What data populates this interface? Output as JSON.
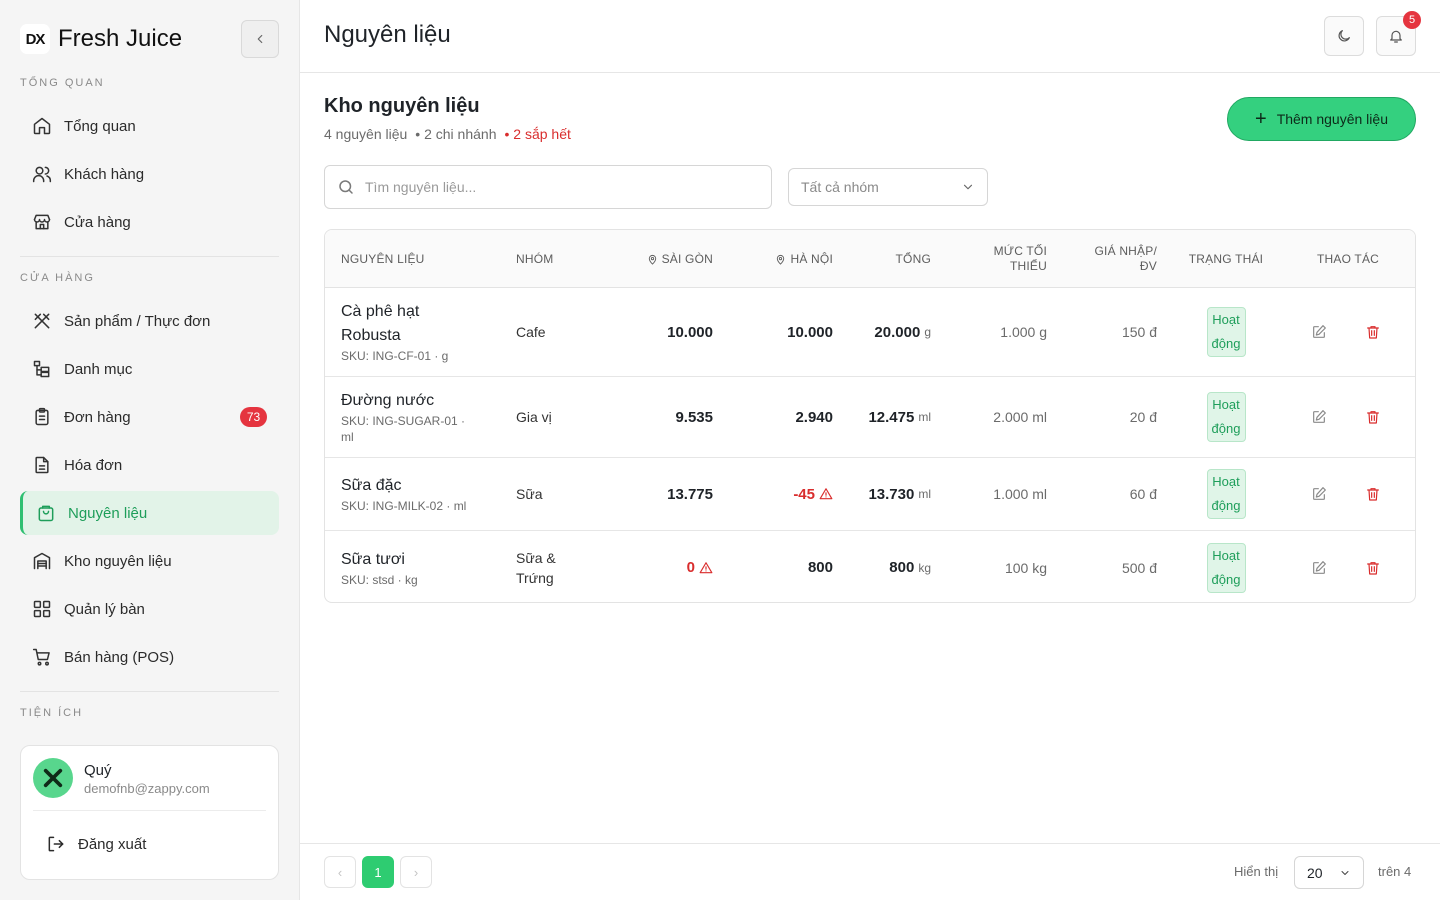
{
  "brand": {
    "logo_text": "DX",
    "name": "Fresh Juice"
  },
  "sidebar": {
    "sections": [
      "TỔNG QUAN",
      "CỬA HÀNG",
      "TIỆN ÍCH"
    ],
    "overview_items": [
      {
        "label": "Tổng quan",
        "icon": "home-icon"
      },
      {
        "label": "Khách hàng",
        "icon": "users-icon"
      },
      {
        "label": "Cửa hàng",
        "icon": "store-icon"
      }
    ],
    "store_items": [
      {
        "label": "Sản phẩm / Thực đơn",
        "icon": "utensils-icon"
      },
      {
        "label": "Danh mục",
        "icon": "category-tree-icon"
      },
      {
        "label": "Đơn hàng",
        "icon": "clipboard-icon",
        "badge": "73"
      },
      {
        "label": "Hóa đơn",
        "icon": "invoice-icon"
      },
      {
        "label": "Nguyên liệu",
        "icon": "shopping-bag-icon",
        "active": true
      },
      {
        "label": "Kho nguyên liệu",
        "icon": "warehouse-icon"
      },
      {
        "label": "Quản lý bàn",
        "icon": "grid-icon"
      },
      {
        "label": "Bán hàng (POS)",
        "icon": "cart-icon"
      }
    ],
    "user": {
      "name": "Quý",
      "email": "demofnb@zappy.com",
      "logout_label": "Đăng xuất"
    }
  },
  "header": {
    "title": "Nguyên liệu",
    "notification_count": "5"
  },
  "content": {
    "title": "Kho nguyên liệu",
    "subtitle_count": "4 nguyên liệu",
    "subtitle_branches": "• 2 chi nhánh",
    "subtitle_warning": "• 2 sắp hết",
    "add_button_label": "Thêm nguyên liệu",
    "search_placeholder": "Tìm nguyên liệu...",
    "group_filter_value": "Tất cả nhóm"
  },
  "table": {
    "columns": {
      "ingredient": "NGUYÊN LIỆU",
      "group": "NHÓM",
      "saigon": "SÀI GÒN",
      "hanoi": "HÀ NỘI",
      "total": "TỔNG",
      "min_level_line1": "MỨC TỐI",
      "min_level_line2": "THIỂU",
      "price_line1": "GIÁ NHẬP/",
      "price_line2": "ĐV",
      "status": "TRẠNG THÁI",
      "actions": "THAO TÁC"
    },
    "rows": [
      {
        "name_line1": "Cà phê hạt",
        "name_line2": "Robusta",
        "sku": "SKU: ING-CF-01 · g",
        "group_line1": "Cafe",
        "group_line2": "",
        "saigon": "10.000",
        "saigon_low": false,
        "hanoi": "10.000",
        "hanoi_low": false,
        "total": "20.000",
        "total_unit": "g",
        "min_level": "1.000 g",
        "price": "150 đ",
        "status_line1": "Hoạt",
        "status_line2": "động"
      },
      {
        "name_line1": "Đường nước",
        "name_line2": "",
        "sku": "SKU: ING-SUGAR-01 ·",
        "sku_line2": "ml",
        "group_line1": "Gia vị",
        "group_line2": "",
        "saigon": "9.535",
        "saigon_low": false,
        "hanoi": "2.940",
        "hanoi_low": false,
        "total": "12.475",
        "total_unit": "ml",
        "min_level": "2.000 ml",
        "price": "20 đ",
        "status_line1": "Hoạt",
        "status_line2": "động"
      },
      {
        "name_line1": "Sữa đặc",
        "name_line2": "",
        "sku": "SKU: ING-MILK-02 · ml",
        "group_line1": "Sữa",
        "group_line2": "",
        "saigon": "13.775",
        "saigon_low": false,
        "hanoi": "-45",
        "hanoi_low": true,
        "total": "13.730",
        "total_unit": "ml",
        "min_level": "1.000 ml",
        "price": "60 đ",
        "status_line1": "Hoạt",
        "status_line2": "động"
      },
      {
        "name_line1": "Sữa tươi",
        "name_line2": "",
        "sku": "SKU: stsd · kg",
        "group_line1": "Sữa &",
        "group_line2": "Trứng",
        "saigon": "0",
        "saigon_low": true,
        "hanoi": "800",
        "hanoi_low": false,
        "total": "800",
        "total_unit": "kg",
        "min_level": "100 kg",
        "price": "500 đ",
        "status_line1": "Hoạt",
        "status_line2": "động"
      }
    ]
  },
  "pagination": {
    "prev_label": "‹",
    "current_page": "1",
    "next_label": "›",
    "show_label": "Hiển thị",
    "page_size": "20",
    "total_label": "trên 4"
  },
  "colors": {
    "accent": "#34d07f",
    "danger": "#d92d2d",
    "active_bg": "#e2f3e8"
  }
}
